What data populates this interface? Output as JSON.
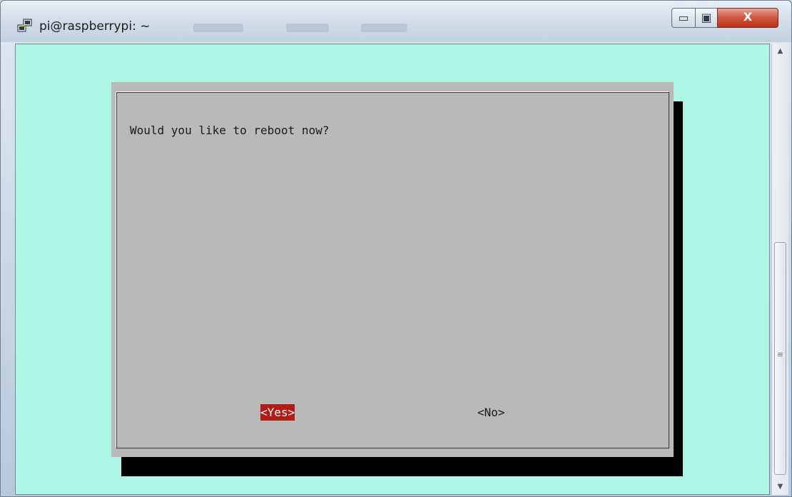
{
  "window": {
    "title": "pi@raspberrypi: ~",
    "icon": "putty-icon",
    "controls": {
      "minimize_glyph": "▭",
      "maximize_glyph": "▣",
      "close_glyph": "X"
    }
  },
  "dialog": {
    "message": "Would you like to reboot now?",
    "yes_label": "<Yes>",
    "no_label": "<No>",
    "selected": "yes"
  },
  "scrollbar": {
    "up_glyph": "▲",
    "down_glyph": "▼",
    "grip_glyph": "≡"
  },
  "colors": {
    "terminal_background": "#abf7e4",
    "dialog_background": "#b9b9b9",
    "dialog_shadow": "#000000",
    "selected_button": "#b41b14"
  }
}
